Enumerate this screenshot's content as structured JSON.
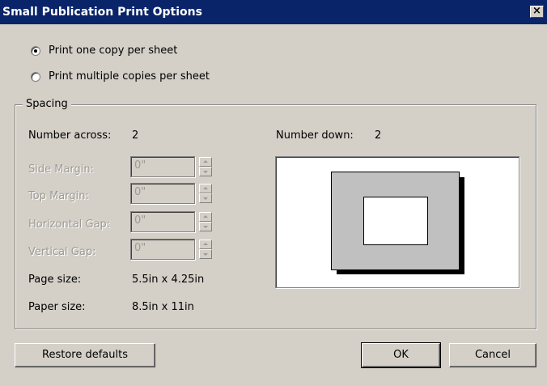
{
  "dialog": {
    "title": "Small Publication Print Options",
    "close_glyph": "×"
  },
  "options": {
    "one_copy": "Print one copy per sheet",
    "multiple_copies": "Print multiple copies per sheet",
    "selected": "one_copy"
  },
  "spacing": {
    "title": "Spacing",
    "number_across_label": "Number across:",
    "number_across_value": "2",
    "number_down_label": "Number down:",
    "number_down_value": "2",
    "side_margin_label": "Side Margin:",
    "side_margin_value": "0\"",
    "top_margin_label": "Top Margin:",
    "top_margin_value": "0\"",
    "horizontal_gap_label": "Horizontal Gap:",
    "horizontal_gap_value": "0\"",
    "vertical_gap_label": "Vertical Gap:",
    "vertical_gap_value": "0\"",
    "page_size_label": "Page size:",
    "page_size_value": "5.5in x 4.25in",
    "paper_size_label": "Paper size:",
    "paper_size_value": "8.5in x 11in"
  },
  "buttons": {
    "restore_defaults": "Restore defaults",
    "ok": "OK",
    "cancel": "Cancel"
  },
  "colors": {
    "title_bar": "#0a246a",
    "dialog_face": "#d4d0c8",
    "disabled_text": "#9c9a94"
  },
  "icons": {
    "close": "close-icon",
    "spin_up": "spin-up-arrow-icon",
    "spin_down": "spin-down-arrow-icon"
  }
}
